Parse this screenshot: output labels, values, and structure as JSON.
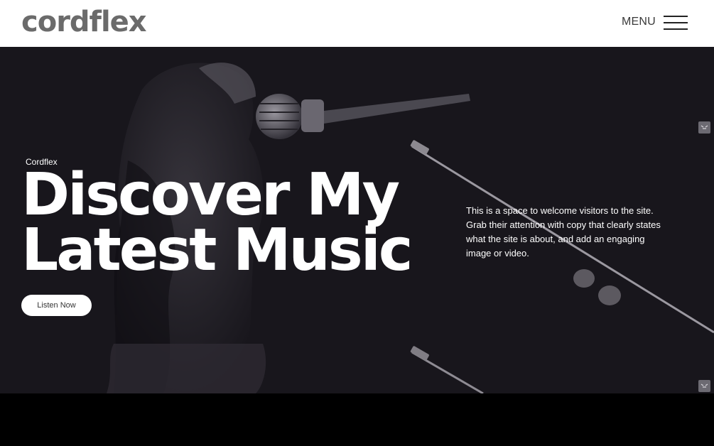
{
  "header": {
    "logo": "cordflex",
    "menu_label": "MENU"
  },
  "hero": {
    "eyebrow": "Cordflex",
    "headline_line1": "Discover My",
    "headline_line2": "Latest Music",
    "cta_label": "Listen Now",
    "intro_text": "This is a space to welcome visitors to the site. Grab their attention with copy that clearly states what the site is about, and add an engaging image or video."
  },
  "icons": {
    "menu": "hamburger-icon",
    "expand": "expand-icon"
  },
  "colors": {
    "header_bg": "#ffffff",
    "logo": "#6b6b6b",
    "hero_bg": "#18161c",
    "hero_text": "#ffffff",
    "cta_bg": "#ffffff",
    "footer_bg": "#000000"
  }
}
